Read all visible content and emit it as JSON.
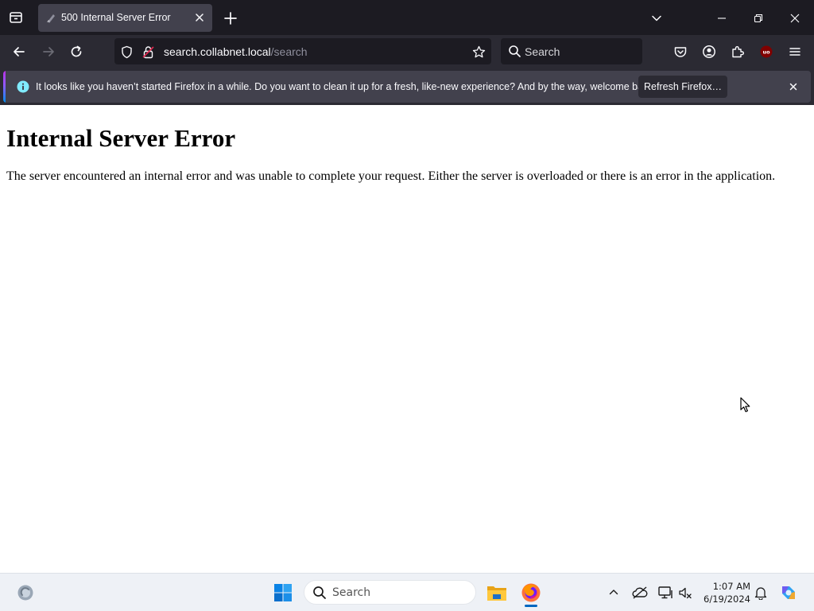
{
  "browser": {
    "tab": {
      "title": "500 Internal Server Error"
    },
    "url": {
      "host": "search.collabnet.local",
      "path": "/search"
    },
    "search_placeholder": "Search",
    "notification": {
      "message": "It looks like you haven’t started Firefox in a while. Do you want to clean it up for a fresh, like-new experience? And by the way, welcome back!",
      "button_label": "Refresh Firefox…"
    },
    "icons": [
      "tab-list-icon",
      "favicon-icon",
      "tab-close-icon",
      "new-tab-icon",
      "list-all-tabs-icon",
      "minimize-icon",
      "restore-icon",
      "window-close-icon",
      "back-icon",
      "forward-icon",
      "reload-icon",
      "shield-icon",
      "lock-icon",
      "bookmark-star-icon",
      "search-icon",
      "pocket-icon",
      "account-icon",
      "extensions-icon",
      "ublock-icon",
      "menu-icon",
      "info-icon",
      "notification-close-icon"
    ]
  },
  "page": {
    "heading": "Internal Server Error",
    "body": "The server encountered an internal error and was unable to complete your request. Either the server is overloaded or there is an error in the application."
  },
  "taskbar": {
    "search_placeholder": "Search",
    "time": "1:07 AM",
    "date": "6/19/2024",
    "icons": [
      "widgets-icon",
      "start-icon",
      "search-icon",
      "file-explorer-icon",
      "firefox-icon",
      "show-hidden-icons-icon",
      "onedrive-icon",
      "network-icon",
      "volume-icon",
      "notifications-icon",
      "copilot-icon"
    ]
  },
  "colors": {
    "tabstrip": "#1c1b22",
    "toolbar": "#2b2a33",
    "selected_tab": "#42414d",
    "info_accent": "#0090ed",
    "taskbar": "#eef1f6"
  }
}
